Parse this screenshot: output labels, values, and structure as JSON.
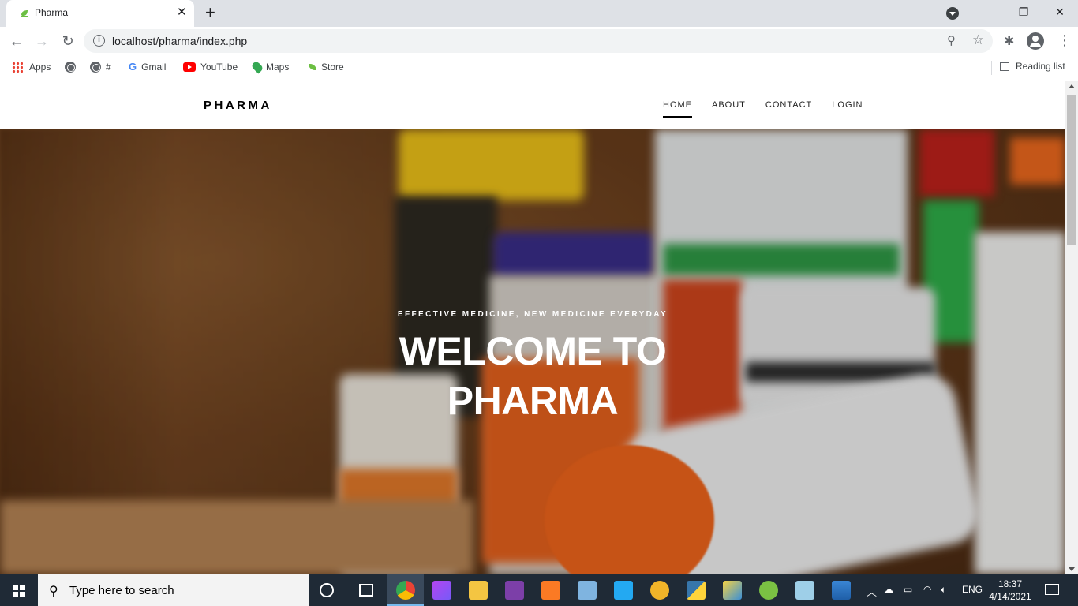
{
  "browser": {
    "tab_title": "Pharma",
    "url": "localhost/pharma/index.php",
    "bookmarks": [
      {
        "label": "Apps",
        "icon": "apps-grid-icon"
      },
      {
        "label": "",
        "icon": "globe-icon"
      },
      {
        "label": "#",
        "icon": "globe-icon"
      },
      {
        "label": "Gmail",
        "icon": "google-icon"
      },
      {
        "label": "YouTube",
        "icon": "youtube-icon"
      },
      {
        "label": "Maps",
        "icon": "maps-icon"
      },
      {
        "label": "Store",
        "icon": "leaf-icon"
      }
    ],
    "reading_list": "Reading list"
  },
  "site": {
    "brand": "PHARMA",
    "nav": [
      {
        "label": "HOME",
        "active": true
      },
      {
        "label": "ABOUT",
        "active": false
      },
      {
        "label": "CONTACT",
        "active": false
      },
      {
        "label": "LOGIN",
        "active": false
      }
    ],
    "hero": {
      "tagline": "EFFECTIVE MEDICINE, NEW MEDICINE EVERYDAY",
      "headline_line1": "WELCOME TO",
      "headline_line2": "PHARMA"
    }
  },
  "taskbar": {
    "search_placeholder": "Type here to search",
    "language": "ENG",
    "time": "18:37",
    "date": "4/14/2021"
  }
}
